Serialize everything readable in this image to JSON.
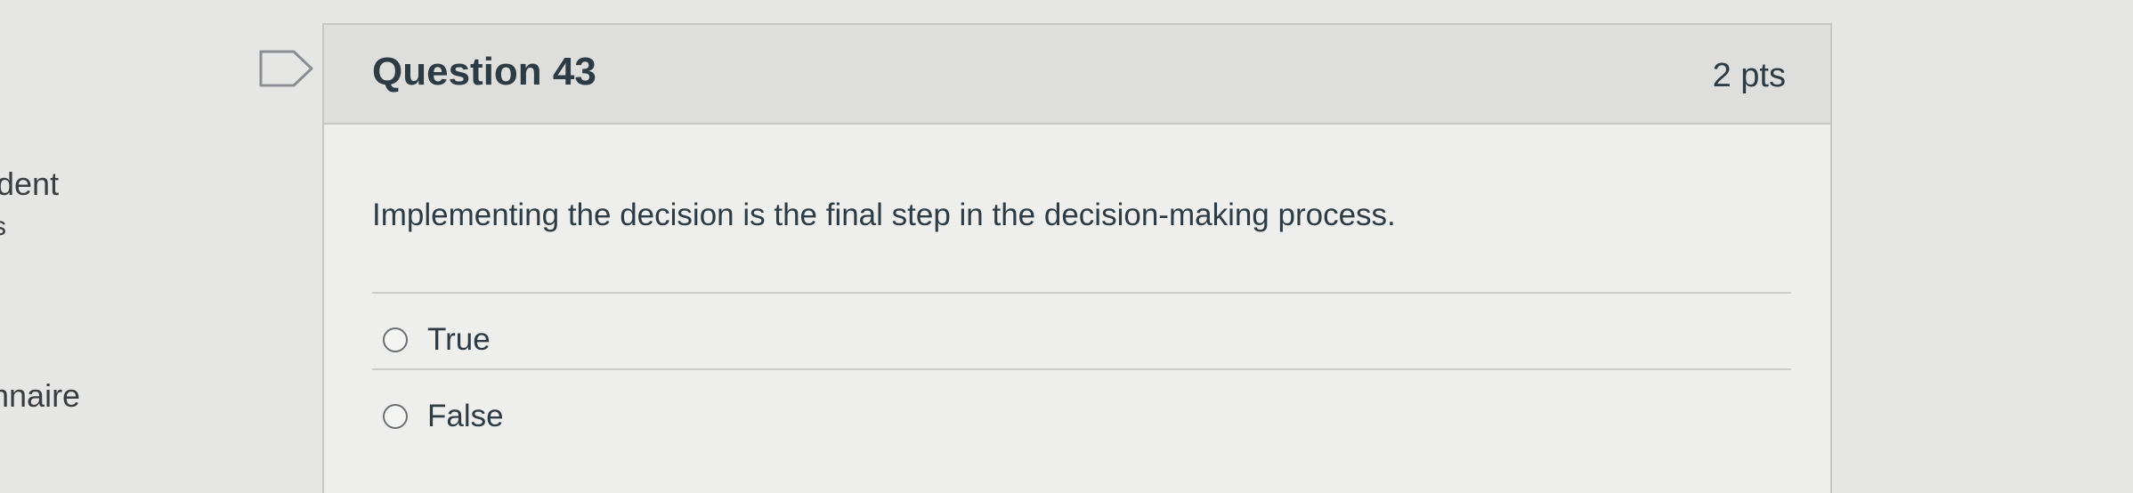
{
  "sidebar": {
    "fragments": [
      "dent",
      "s",
      "nnaire"
    ]
  },
  "question": {
    "title": "Question 43",
    "points": "2 pts",
    "text": "Implementing the decision is the final step in the decision-making process.",
    "flag_icon": "bookmark-flag-icon",
    "answers": [
      {
        "label": "True",
        "selected": false
      },
      {
        "label": "False",
        "selected": false
      }
    ]
  }
}
